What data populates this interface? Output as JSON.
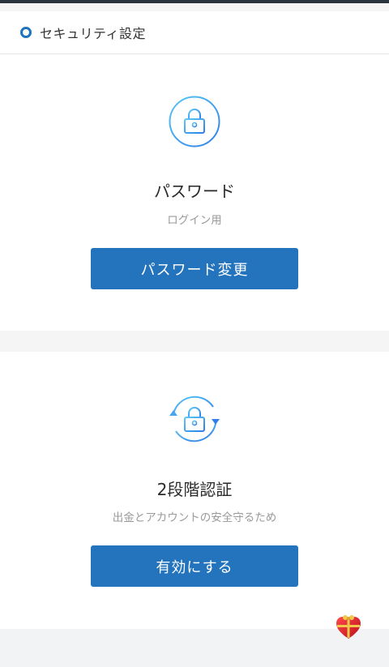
{
  "header": {
    "title": "セキュリティ設定"
  },
  "password_card": {
    "icon": "lock-icon",
    "title": "パスワード",
    "subtitle": "ログイン用",
    "button_label": "パスワード変更"
  },
  "twofa_card": {
    "icon": "lock-refresh-icon",
    "title": "2段階認証",
    "subtitle": "出金とアカウントの安全守るため",
    "button_label": "有効にする"
  },
  "floating": {
    "icon": "gift-heart-icon"
  },
  "colors": {
    "accent": "#2473bd",
    "icon_gradient_start": "#5bc6f5",
    "icon_gradient_end": "#2f7fe8"
  }
}
